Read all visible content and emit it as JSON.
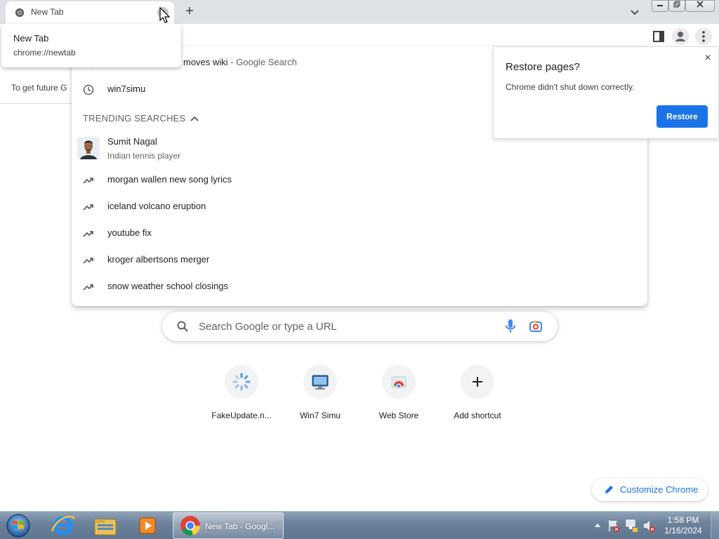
{
  "browser": {
    "tab": {
      "title": "New Tab",
      "close_glyph": "×"
    },
    "new_tab_glyph": "+",
    "hovercard": {
      "title": "New Tab",
      "url": "chrome://newtab"
    },
    "window_buttons": [
      "minimize",
      "restore",
      "close"
    ]
  },
  "sync_banner": {
    "text": "To get future G"
  },
  "omnibox_dropdown": {
    "history_rows": [
      {
        "icon": "search-icon",
        "text": "moves wiki",
        "suffix": " - Google Search"
      },
      {
        "icon": "clock-icon",
        "text": "win7simu",
        "suffix": ""
      }
    ],
    "trending_header": "TRENDING SEARCHES",
    "entity": {
      "name": "Sumit Nagal",
      "description": "Indian tennis player"
    },
    "trending": [
      "morgan wallen new song lyrics",
      "iceland volcano eruption",
      "youtube fix",
      "kroger albertsons merger",
      "snow weather school closings"
    ]
  },
  "restore_bubble": {
    "title": "Restore pages?",
    "message": "Chrome didn't shut down correctly.",
    "button": "Restore",
    "close_glyph": "×"
  },
  "ntp": {
    "search_placeholder": "Search Google or type a URL",
    "shortcuts": [
      {
        "label": "FakeUpdate.n...",
        "icon": "spinner-icon"
      },
      {
        "label": "Win7 Simu",
        "icon": "monitor-icon"
      },
      {
        "label": "Web Store",
        "icon": "web-store-icon"
      },
      {
        "label": "Add shortcut",
        "icon": "plus-icon"
      }
    ],
    "customize_label": "Customize Chrome"
  },
  "taskbar": {
    "pinned": [
      "internet-explorer-icon",
      "explorer-icon",
      "media-player-icon"
    ],
    "active_app_label": "New Tab - Googl...",
    "clock_time": "1:58 PM",
    "clock_date": "1/16/2024"
  },
  "colors": {
    "accent": "#1a73e8",
    "tabstrip": "#dee1e6",
    "taskbar": "#6d839b"
  }
}
